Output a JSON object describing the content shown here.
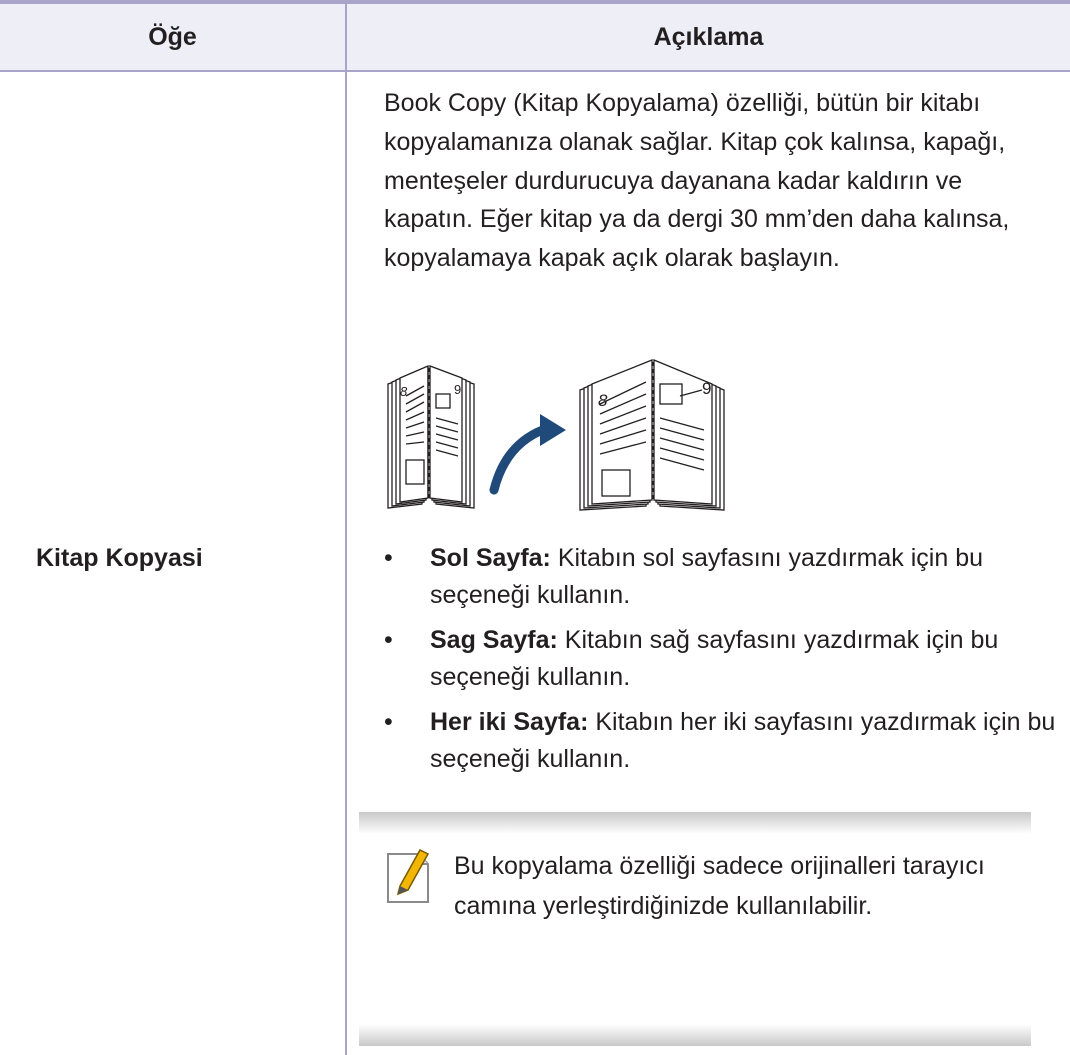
{
  "table": {
    "header": {
      "item": "Öğe",
      "description": "Açıklama"
    },
    "row": {
      "item": "Kitap Kopyasi",
      "description": "Book Copy (Kitap Kopyalama) özelliği, bütün bir kitabı kopyalamanıza olanak sağlar. Kitap çok kalınsa, kapağı, menteşeler durdurucuya dayanana kadar kaldırın ve kapatın. Eğer kitap ya da dergi 30 mm’den daha kalınsa, kopyalamaya kapak açık olarak başlayın.",
      "illustration": {
        "left_page_numbers": [
          "8",
          "9"
        ],
        "right_page_numbers": [
          "8",
          "9"
        ]
      },
      "bullets": [
        {
          "term": "Sol Sayfa:",
          "text": " Kitabın sol sayfasını yazdırmak için bu seçeneği kullanın."
        },
        {
          "term": "Sag Sayfa:",
          "text": " Kitabın sağ sayfasını yazdırmak için bu seçeneği kullanın."
        },
        {
          "term": "Her iki Sayfa:",
          "text": " Kitabın her iki sayfasını yazdırmak için bu seçeneği kullanın."
        }
      ],
      "note": {
        "icon": "note-pencil-icon",
        "text": "Bu kopyalama özelliği sadece orijinalleri tarayıcı camına yerleştirdiğinizde kullanılabilir."
      }
    }
  },
  "colors": {
    "rule": "#a7a3c9",
    "header_bg": "#eeeef7",
    "text": "#231f20",
    "arrow": "#1f4a7a"
  }
}
